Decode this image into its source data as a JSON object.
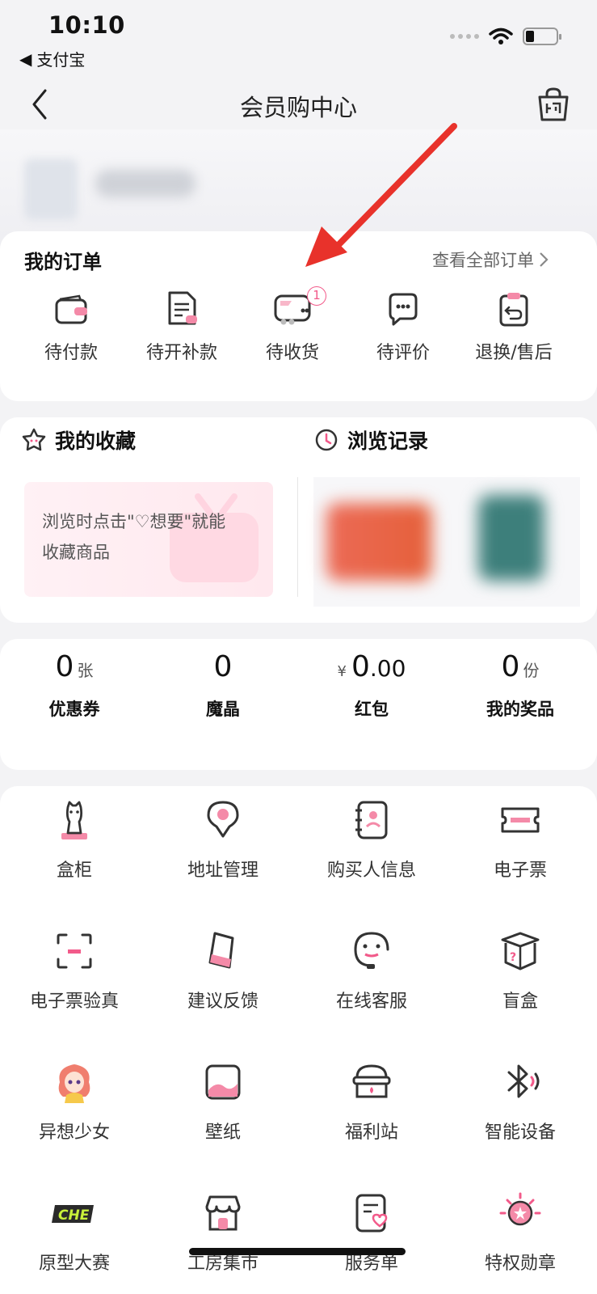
{
  "status_bar": {
    "time": "10:10",
    "back_app": "支付宝"
  },
  "nav": {
    "title": "会员购中心"
  },
  "orders": {
    "title": "我的订单",
    "view_all": "查看全部订单",
    "items": [
      {
        "label": "待付款",
        "icon": "wallet-icon"
      },
      {
        "label": "待开补款",
        "icon": "invoice-icon"
      },
      {
        "label": "待收货",
        "icon": "truck-icon",
        "badge": "1"
      },
      {
        "label": "待评价",
        "icon": "review-chat-icon"
      },
      {
        "label": "退换/售后",
        "icon": "return-icon"
      }
    ]
  },
  "collections": {
    "favorites_title": "我的收藏",
    "history_title": "浏览记录",
    "empty_line1": "浏览时点击\"♡想要\"就能",
    "empty_line2": "收藏商品"
  },
  "stats": [
    {
      "value": "0",
      "unit": "张",
      "label": "优惠券"
    },
    {
      "value": "0",
      "unit": "",
      "label": "魔晶"
    },
    {
      "currency": "¥",
      "value": "0",
      "cents": ".00",
      "label": "红包"
    },
    {
      "value": "0",
      "unit": "份",
      "label": "我的奖品"
    }
  ],
  "tools": [
    {
      "label": "盒柜",
      "icon": "box-cabinet-icon"
    },
    {
      "label": "地址管理",
      "icon": "location-pin-icon"
    },
    {
      "label": "购买人信息",
      "icon": "contact-book-icon"
    },
    {
      "label": "电子票",
      "icon": "ticket-icon"
    },
    {
      "label": "电子票验真",
      "icon": "scan-icon"
    },
    {
      "label": "建议反馈",
      "icon": "feedback-icon"
    },
    {
      "label": "在线客服",
      "icon": "customer-service-icon"
    },
    {
      "label": "盲盒",
      "icon": "blind-box-icon"
    },
    {
      "label": "异想少女",
      "icon": "anime-girl-icon"
    },
    {
      "label": "壁纸",
      "icon": "wallpaper-icon"
    },
    {
      "label": "福利站",
      "icon": "welfare-basket-icon"
    },
    {
      "label": "智能设备",
      "icon": "bluetooth-icon"
    },
    {
      "label": "原型大赛",
      "icon": "che-logo-icon"
    },
    {
      "label": "工房集市",
      "icon": "market-shop-icon"
    },
    {
      "label": "服务单",
      "icon": "service-order-icon"
    },
    {
      "label": "特权勋章",
      "icon": "medal-icon"
    }
  ],
  "colors": {
    "accent_pink": "#f25a8a",
    "arrow_red": "#e8322b"
  }
}
